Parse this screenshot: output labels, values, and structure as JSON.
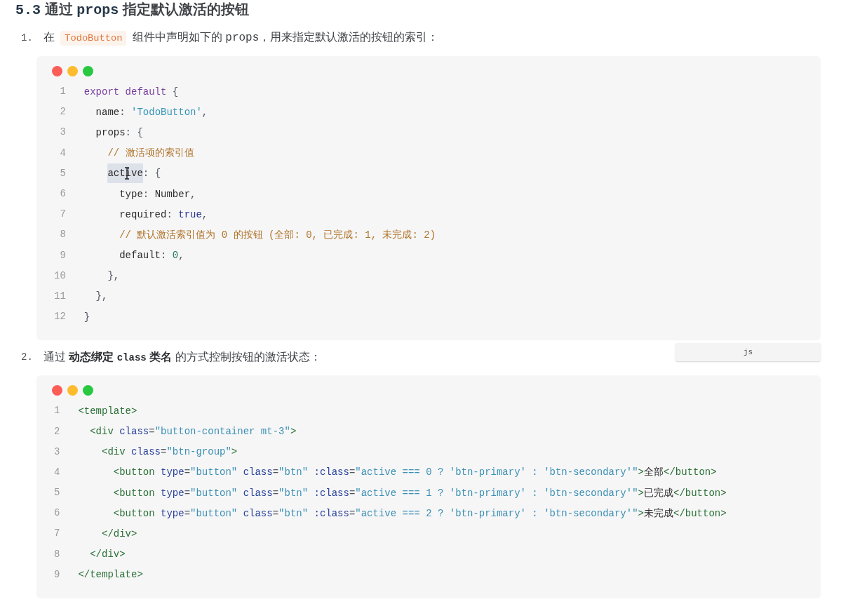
{
  "heading": {
    "segments": [
      {
        "kind": "mono",
        "text": "5.3"
      },
      {
        "kind": "text",
        "text": " 通过 "
      },
      {
        "kind": "mono",
        "text": "props"
      },
      {
        "kind": "text",
        "text": " 指定默认激活的按钮"
      }
    ]
  },
  "steps": [
    {
      "number": "1.",
      "segments": [
        {
          "kind": "text",
          "text": "在 "
        },
        {
          "kind": "code",
          "text": "TodoButton"
        },
        {
          "kind": "text",
          "text": " 组件中声明如下的 "
        },
        {
          "kind": "mono",
          "text": "props"
        },
        {
          "kind": "text",
          "text": "，用来指定默认激活的按钮的索引："
        }
      ],
      "code": {
        "language": "js",
        "lines": [
          {
            "number": "1",
            "tokens": [
              {
                "kind": "keyword",
                "text": "export default"
              },
              {
                "kind": "punct",
                "text": " {"
              }
            ]
          },
          {
            "number": "2",
            "tokens": [
              {
                "kind": "property",
                "text": "  name"
              },
              {
                "kind": "punct",
                "text": ": "
              },
              {
                "kind": "string",
                "text": "'TodoButton'"
              },
              {
                "kind": "punct",
                "text": ","
              }
            ]
          },
          {
            "number": "3",
            "tokens": [
              {
                "kind": "property",
                "text": "  props"
              },
              {
                "kind": "punct",
                "text": ": {"
              }
            ]
          },
          {
            "number": "4",
            "tokens": [
              {
                "kind": "comment",
                "text": "    // 激活项的索引值"
              }
            ]
          },
          {
            "number": "5",
            "tokens": [
              {
                "kind": "property",
                "text": "    active",
                "highlighted": true,
                "pointer": true
              },
              {
                "kind": "punct",
                "text": ": {",
                "highlighted": false,
                "pointer": false
              }
            ]
          },
          {
            "number": "6",
            "tokens": [
              {
                "kind": "property",
                "text": "      type"
              },
              {
                "kind": "punct",
                "text": ": "
              },
              {
                "kind": "identifier",
                "text": "Number"
              },
              {
                "kind": "punct",
                "text": ","
              }
            ]
          },
          {
            "number": "7",
            "tokens": [
              {
                "kind": "property",
                "text": "      required"
              },
              {
                "kind": "punct",
                "text": ": "
              },
              {
                "kind": "boolean",
                "text": "true"
              },
              {
                "kind": "punct",
                "text": ","
              }
            ]
          },
          {
            "number": "8",
            "tokens": [
              {
                "kind": "comment",
                "text": "      // 默认激活索引值为 0 的按钮 (全部: 0, 已完成: 1, 未完成: 2)"
              }
            ]
          },
          {
            "number": "9",
            "tokens": [
              {
                "kind": "property",
                "text": "      default"
              },
              {
                "kind": "punct",
                "text": ": "
              },
              {
                "kind": "number",
                "text": "0"
              },
              {
                "kind": "punct",
                "text": ","
              }
            ]
          },
          {
            "number": "10",
            "tokens": [
              {
                "kind": "punct",
                "text": "    },"
              }
            ]
          },
          {
            "number": "11",
            "tokens": [
              {
                "kind": "punct",
                "text": "  },"
              }
            ]
          },
          {
            "number": "12",
            "tokens": [
              {
                "kind": "punct",
                "text": "}"
              }
            ]
          }
        ]
      }
    },
    {
      "number": "2.",
      "segments": [
        {
          "kind": "text",
          "text": "通过 "
        },
        {
          "kind": "bold",
          "text": "动态绑定 "
        },
        {
          "kind": "bold_mono",
          "text": "class"
        },
        {
          "kind": "bold",
          "text": " 类名"
        },
        {
          "kind": "text",
          "text": " 的方式控制按钮的激活状态："
        }
      ],
      "code": {
        "lines": [
          {
            "number": "1",
            "tokens": [
              {
                "kind": "tag",
                "text": "<template>"
              }
            ]
          },
          {
            "number": "2",
            "tokens": [
              {
                "kind": "tag",
                "text": "  <div"
              },
              {
                "kind": "attr",
                "text": " class"
              },
              {
                "kind": "punct",
                "text": "="
              },
              {
                "kind": "value",
                "text": "\"button-container mt-3\""
              },
              {
                "kind": "tag",
                "text": ">"
              }
            ]
          },
          {
            "number": "3",
            "tokens": [
              {
                "kind": "tag",
                "text": "    <div"
              },
              {
                "kind": "attr",
                "text": " class"
              },
              {
                "kind": "punct",
                "text": "="
              },
              {
                "kind": "value",
                "text": "\"btn-group\""
              },
              {
                "kind": "tag",
                "text": ">"
              }
            ]
          },
          {
            "number": "4",
            "tokens": [
              {
                "kind": "tag",
                "text": "      <button"
              },
              {
                "kind": "attr",
                "text": " type"
              },
              {
                "kind": "punct",
                "text": "="
              },
              {
                "kind": "value",
                "text": "\"button\""
              },
              {
                "kind": "attr",
                "text": " class"
              },
              {
                "kind": "punct",
                "text": "="
              },
              {
                "kind": "value",
                "text": "\"btn\""
              },
              {
                "kind": "attr",
                "text": " :class"
              },
              {
                "kind": "punct",
                "text": "="
              },
              {
                "kind": "value",
                "text": "\"active === 0 ? 'btn-primary' : 'btn-secondary'\""
              },
              {
                "kind": "tag",
                "text": ">"
              },
              {
                "kind": "text",
                "text": "全部"
              },
              {
                "kind": "tag",
                "text": "</button>"
              }
            ]
          },
          {
            "number": "5",
            "tokens": [
              {
                "kind": "tag",
                "text": "      <button"
              },
              {
                "kind": "attr",
                "text": " type"
              },
              {
                "kind": "punct",
                "text": "="
              },
              {
                "kind": "value",
                "text": "\"button\""
              },
              {
                "kind": "attr",
                "text": " class"
              },
              {
                "kind": "punct",
                "text": "="
              },
              {
                "kind": "value",
                "text": "\"btn\""
              },
              {
                "kind": "attr",
                "text": " :class"
              },
              {
                "kind": "punct",
                "text": "="
              },
              {
                "kind": "value",
                "text": "\"active === 1 ? 'btn-primary' : 'btn-secondary'\""
              },
              {
                "kind": "tag",
                "text": ">"
              },
              {
                "kind": "text",
                "text": "已完成"
              },
              {
                "kind": "tag",
                "text": "</button>"
              }
            ]
          },
          {
            "number": "6",
            "tokens": [
              {
                "kind": "tag",
                "text": "      <button"
              },
              {
                "kind": "attr",
                "text": " type"
              },
              {
                "kind": "punct",
                "text": "="
              },
              {
                "kind": "value",
                "text": "\"button\""
              },
              {
                "kind": "attr",
                "text": " class"
              },
              {
                "kind": "punct",
                "text": "="
              },
              {
                "kind": "value",
                "text": "\"btn\""
              },
              {
                "kind": "attr",
                "text": " :class"
              },
              {
                "kind": "punct",
                "text": "="
              },
              {
                "kind": "value",
                "text": "\"active === 2 ? 'btn-primary' : 'btn-secondary'\""
              },
              {
                "kind": "tag",
                "text": ">"
              },
              {
                "kind": "text",
                "text": "未完成"
              },
              {
                "kind": "tag",
                "text": "</button>"
              }
            ]
          },
          {
            "number": "7",
            "tokens": [
              {
                "kind": "tag",
                "text": "    </div>"
              }
            ]
          },
          {
            "number": "8",
            "tokens": [
              {
                "kind": "tag",
                "text": "  </div>"
              }
            ]
          },
          {
            "number": "9",
            "tokens": [
              {
                "kind": "tag",
                "text": "</template>"
              }
            ]
          }
        ]
      }
    }
  ]
}
